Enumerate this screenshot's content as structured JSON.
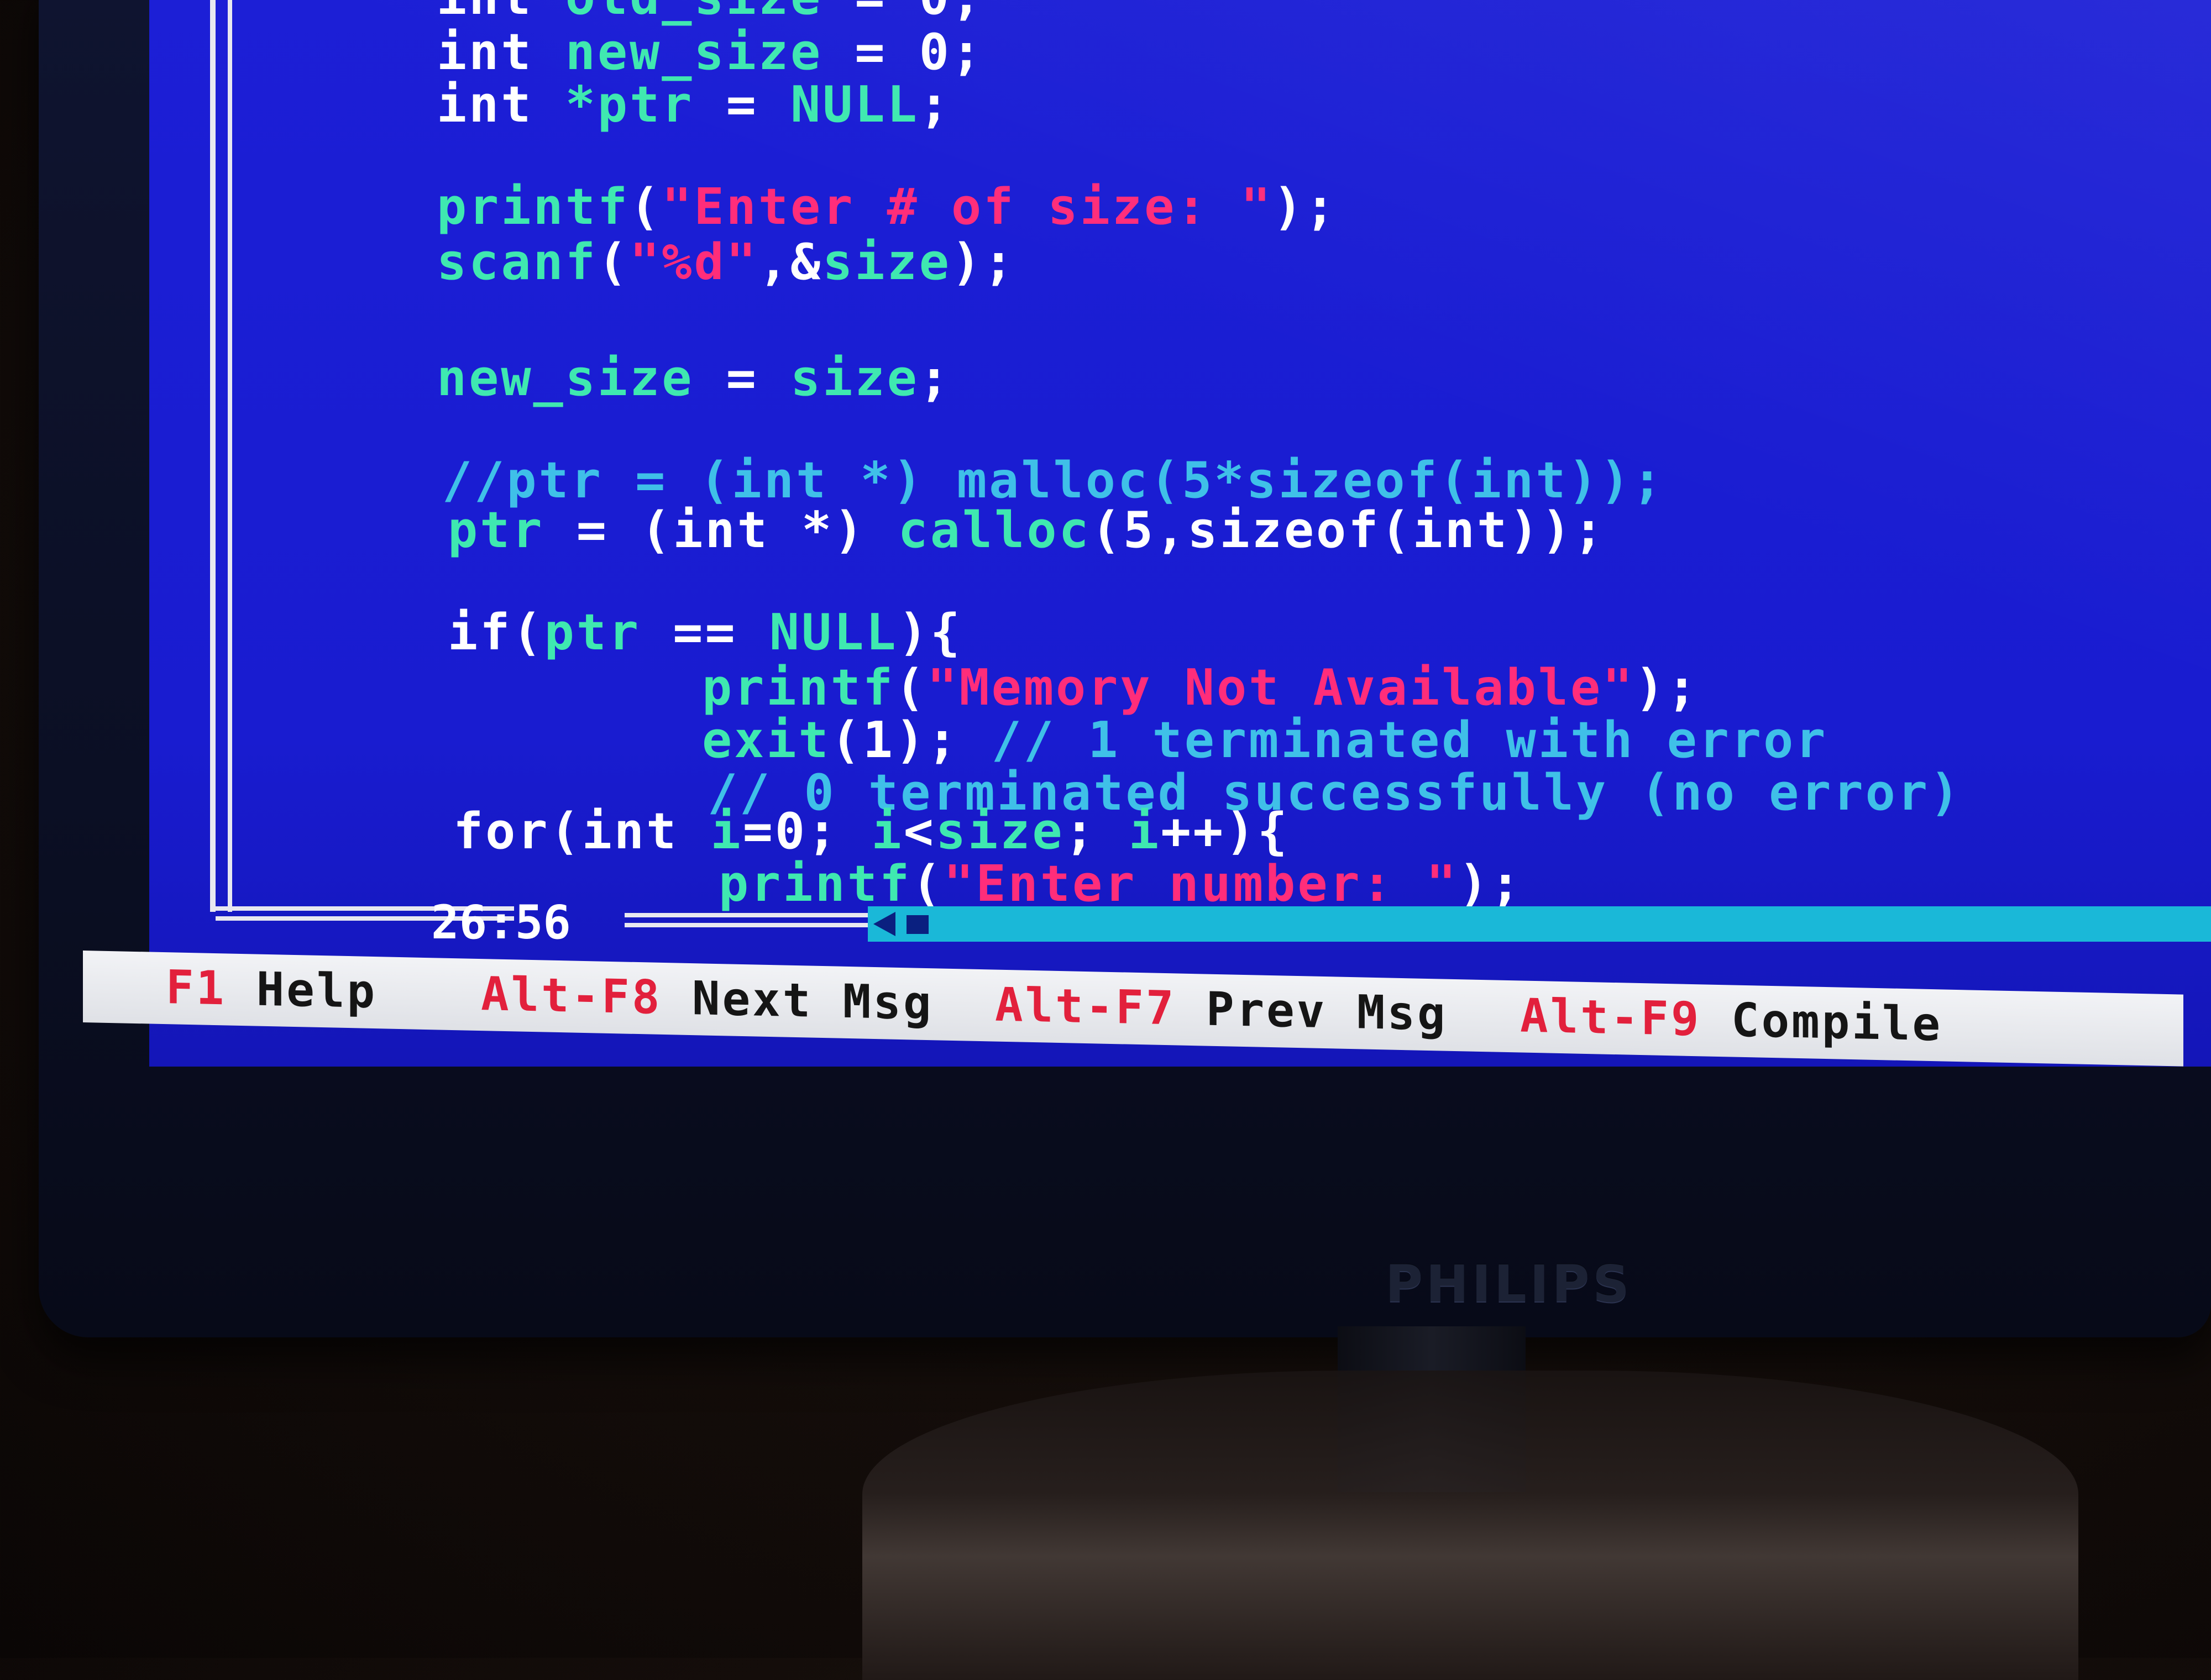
{
  "editor": {
    "code_lines": [
      {
        "parts": [
          {
            "t": "int ",
            "c": "kw"
          },
          {
            "t": "old_size",
            "c": "id"
          },
          {
            "t": " = ",
            "c": "pn"
          },
          {
            "t": "0;",
            "c": "pn"
          }
        ]
      },
      {
        "parts": [
          {
            "t": "int ",
            "c": "kw"
          },
          {
            "t": "new_size",
            "c": "id"
          },
          {
            "t": " = ",
            "c": "pn"
          },
          {
            "t": "0;",
            "c": "pn"
          }
        ]
      },
      {
        "parts": [
          {
            "t": "int ",
            "c": "kw"
          },
          {
            "t": "*ptr",
            "c": "id"
          },
          {
            "t": " = ",
            "c": "pn"
          },
          {
            "t": "NULL",
            "c": "id"
          },
          {
            "t": ";",
            "c": "pn"
          }
        ]
      },
      {
        "parts": [
          {
            "t": "printf",
            "c": "id"
          },
          {
            "t": "(",
            "c": "pn"
          },
          {
            "t": "\"Enter # of size: \"",
            "c": "str"
          },
          {
            "t": ");",
            "c": "pn"
          }
        ]
      },
      {
        "parts": [
          {
            "t": "scanf",
            "c": "id"
          },
          {
            "t": "(",
            "c": "pn"
          },
          {
            "t": "\"%d\"",
            "c": "str"
          },
          {
            "t": ",&",
            "c": "pn"
          },
          {
            "t": "size",
            "c": "id"
          },
          {
            "t": ");",
            "c": "pn"
          }
        ]
      },
      {
        "parts": [
          {
            "t": "new_size",
            "c": "id"
          },
          {
            "t": " = ",
            "c": "pn"
          },
          {
            "t": "size",
            "c": "id"
          },
          {
            "t": ";",
            "c": "pn"
          }
        ]
      },
      {
        "parts": [
          {
            "t": "//ptr = (int *) malloc(5*sizeof(int));",
            "c": "cm"
          }
        ]
      },
      {
        "parts": [
          {
            "t": "ptr",
            "c": "id"
          },
          {
            "t": " = (",
            "c": "pn"
          },
          {
            "t": "int ",
            "c": "kw"
          },
          {
            "t": "*) ",
            "c": "pn"
          },
          {
            "t": "calloc",
            "c": "id"
          },
          {
            "t": "(5,",
            "c": "pn"
          },
          {
            "t": "sizeof",
            "c": "kw"
          },
          {
            "t": "(",
            "c": "pn"
          },
          {
            "t": "int",
            "c": "kw"
          },
          {
            "t": "));",
            "c": "pn"
          }
        ]
      },
      {
        "parts": [
          {
            "t": "if",
            "c": "kw"
          },
          {
            "t": "(",
            "c": "pn"
          },
          {
            "t": "ptr",
            "c": "id"
          },
          {
            "t": " == ",
            "c": "pn"
          },
          {
            "t": "NULL",
            "c": "id"
          },
          {
            "t": "){",
            "c": "pn"
          }
        ]
      },
      {
        "parts": [
          {
            "t": "printf",
            "c": "id"
          },
          {
            "t": "(",
            "c": "pn"
          },
          {
            "t": "\"Memory Not Available\"",
            "c": "str"
          },
          {
            "t": ");",
            "c": "pn"
          }
        ]
      },
      {
        "parts": [
          {
            "t": "exit",
            "c": "id"
          },
          {
            "t": "(1); ",
            "c": "pn"
          },
          {
            "t": "// 1 terminated with error",
            "c": "cm"
          }
        ]
      },
      {
        "parts": [
          {
            "t": "// 0 terminated successfully (no error)",
            "c": "cm"
          }
        ]
      },
      {
        "parts": [
          {
            "t": "for",
            "c": "kw"
          },
          {
            "t": "(",
            "c": "pn"
          },
          {
            "t": "int ",
            "c": "kw"
          },
          {
            "t": "i",
            "c": "id"
          },
          {
            "t": "=0; ",
            "c": "pn"
          },
          {
            "t": "i",
            "c": "id"
          },
          {
            "t": "<",
            "c": "pn"
          },
          {
            "t": "size",
            "c": "id"
          },
          {
            "t": "; ",
            "c": "pn"
          },
          {
            "t": "i",
            "c": "id"
          },
          {
            "t": "++){",
            "c": "pn"
          }
        ]
      },
      {
        "parts": [
          {
            "t": "printf",
            "c": "id"
          },
          {
            "t": "(",
            "c": "pn"
          },
          {
            "t": "\"Enter number: \"",
            "c": "str"
          },
          {
            "t": ");",
            "c": "pn"
          }
        ]
      }
    ],
    "cursor_position": "26:56"
  },
  "status_bar": [
    {
      "key": "F1",
      "label": " Help"
    },
    {
      "key": "Alt-F8",
      "label": " Next Msg"
    },
    {
      "key": "Alt-F7",
      "label": " Prev Msg"
    },
    {
      "key": "Alt-F9",
      "label": " Compile"
    }
  ],
  "monitor": {
    "brand": "PHILIPS"
  },
  "colors": {
    "screen_bg": "#1a1dd2",
    "keyword": "#ffffff",
    "identifier": "#3fe8b0",
    "string": "#ff2d7a",
    "comment": "#3fc0e8",
    "status_key": "#e2203c",
    "status_bg": "#e8e9ee"
  }
}
